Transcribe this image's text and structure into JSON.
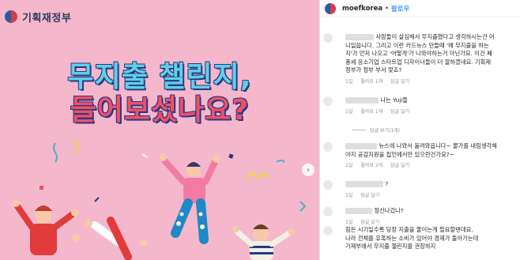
{
  "post": {
    "brand_name": "기획재정부",
    "headline_line1": "무지출 챌린지,",
    "headline_line2": "들어보셨나요?"
  },
  "panel": {
    "username": "moefkorea",
    "separator": "•",
    "follow_label": "팔로우"
  },
  "comments": [
    {
      "lines": [
        "사람들이 살심해서 무지출했다고 생각하시는건 어",
        "니일씁니다. 그리고 이런 카드뉴스 만들때 '왜 무지출을 하는",
        "지'가 먼저 나오고 '어떻게'가 나와야하는거 아닌가요. 이건 폐",
        "풍세 응소기업 스타트업 디자이너들이 더 잘하겠네요. 기획재",
        "정부가 정부 부서 맞죠?"
      ],
      "time": "1일",
      "likes": "좋아요 1개",
      "reply": "답글 달기"
    },
    {
      "lines": [
        "나는 Yuji들"
      ],
      "time": "1일",
      "likes": "좋아요 1개",
      "reply": "답글 달기"
    },
    {
      "replies_toggle": "답글 보기(1개)"
    },
    {
      "lines": [
        "뉴스에 나와서 올려와읍니다~ 물가를 내림생각해",
        "야지 공감지원을 집인에서만 있으란건가요?~"
      ],
      "time": "1일",
      "likes": "좋아요 2개",
      "reply": "답글 달기"
    },
    {
      "lines": [
        "?"
      ],
      "time": "1일",
      "reply": "답글 달기"
    },
    {
      "lines": [
        "정신나갔나?"
      ],
      "time": "1일",
      "reply": "답글 달기"
    },
    {
      "lines": [
        "힘든 시기일수록 당장 지출을 줄이는게 필요할텐데요.",
        "나라 전체를 유혹하는 소비가 있어야 경제가 돌아가는데",
        "기재부에서 무지출 챌린지를 권장하지"
      ],
      "time": "1일",
      "likes": "좋아요 1개",
      "reply": "답글 달기"
    }
  ],
  "colors": {
    "image_bg": "#f5b7cb",
    "headline_cyan": "#5fd0e6",
    "headline_pink": "#f04f66",
    "headline_outline": "#263a86",
    "follow_blue": "#3897f0"
  }
}
